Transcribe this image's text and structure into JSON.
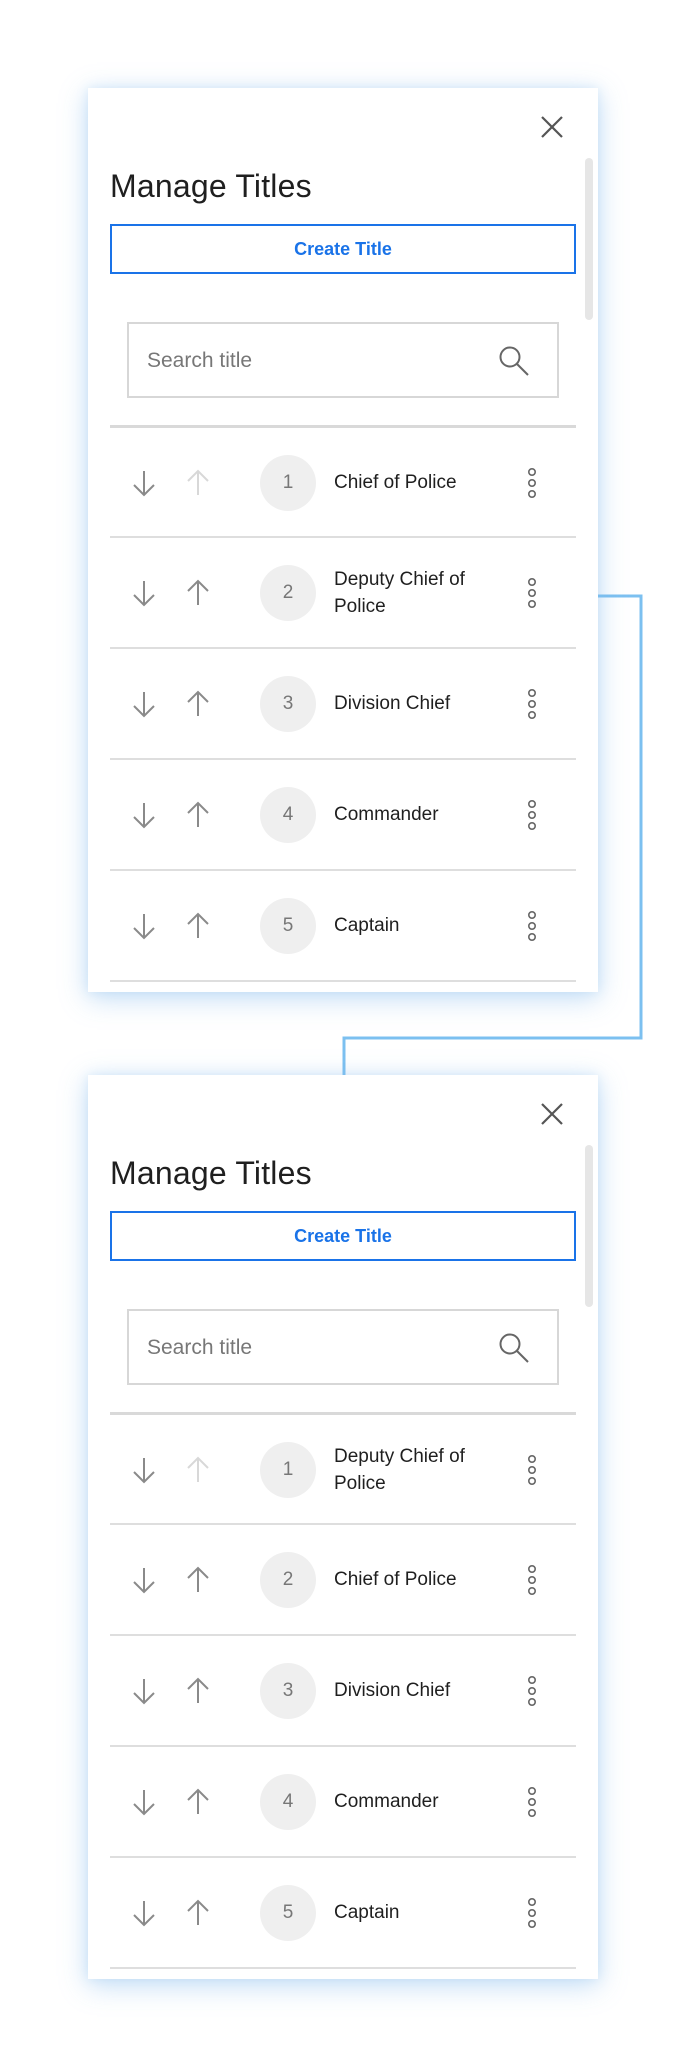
{
  "panels": [
    {
      "title": "Manage Titles",
      "create_button_label": "Create Title",
      "search": {
        "placeholder": "Search title",
        "value": ""
      },
      "rows": [
        {
          "number": "1",
          "label": "Chief of Police",
          "up_enabled": false,
          "down_enabled": true
        },
        {
          "number": "2",
          "label": "Deputy Chief of Police",
          "up_enabled": true,
          "down_enabled": true
        },
        {
          "number": "3",
          "label": "Division Chief",
          "up_enabled": true,
          "down_enabled": true
        },
        {
          "number": "4",
          "label": "Commander",
          "up_enabled": true,
          "down_enabled": true
        },
        {
          "number": "5",
          "label": "Captain",
          "up_enabled": true,
          "down_enabled": true
        }
      ]
    },
    {
      "title": "Manage Titles",
      "create_button_label": "Create Title",
      "search": {
        "placeholder": "Search title",
        "value": ""
      },
      "rows": [
        {
          "number": "1",
          "label": "Deputy Chief of Police",
          "up_enabled": false,
          "down_enabled": true
        },
        {
          "number": "2",
          "label": "Chief of Police",
          "up_enabled": true,
          "down_enabled": true
        },
        {
          "number": "3",
          "label": "Division Chief",
          "up_enabled": true,
          "down_enabled": true
        },
        {
          "number": "4",
          "label": "Commander",
          "up_enabled": true,
          "down_enabled": true
        },
        {
          "number": "5",
          "label": "Captain",
          "up_enabled": true,
          "down_enabled": true
        }
      ]
    }
  ],
  "icons": {
    "close": "close-icon",
    "search": "search-icon",
    "move_down": "arrow-down-icon",
    "move_up": "arrow-up-icon",
    "more": "more-vertical-icon"
  },
  "colors": {
    "accent": "#1a73e8",
    "connector": "#7cc0f0",
    "arrow_enabled": "#8a8a8a",
    "arrow_disabled": "#d8d8d8",
    "badge_bg": "#efefef"
  }
}
